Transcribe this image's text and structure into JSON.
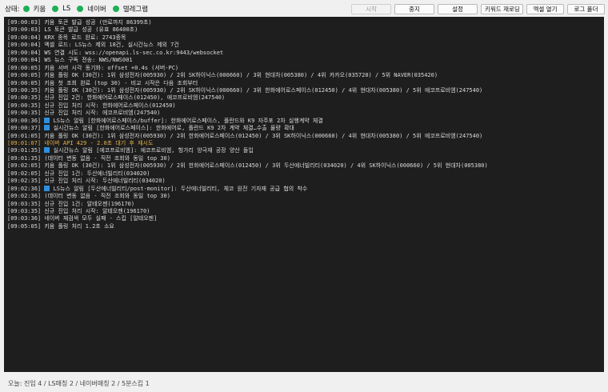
{
  "status": {
    "label": "상태:",
    "indicators": [
      {
        "label": "키움",
        "color": "#1fae55"
      },
      {
        "label": "LS",
        "color": "#1fae55"
      },
      {
        "label": "네이버",
        "color": "#1fae55"
      },
      {
        "label": "텔레그램",
        "color": "#1fae55"
      }
    ]
  },
  "toolbar": {
    "start": "시작",
    "stop": "중지",
    "settings": "설정",
    "keyword_reload": "키워드 재로딩",
    "excel_open": "엑셀 열기",
    "log_folder": "로그 폴더"
  },
  "log": [
    {
      "text": "[09:00:03] 키움 토큰 발급 성공 (만료까지 86399초)"
    },
    {
      "text": "[09:00:03] LS 토큰 발급 성공 (유효 86400초)"
    },
    {
      "text": "[09:00:04] KRX 종목 로드 완료: 2743종목"
    },
    {
      "text": "[09:00:04] 엑셀 로드: LS뉴스 제외 18건, 실시간뉴스 제외 7건"
    },
    {
      "text": "[09:00:04] WS 연결 시도: wss://openapi.ls-sec.co.kr:9443/websocket"
    },
    {
      "text": "[09:00:04] WS 뉴스 구독 전송: NWS/NWS001"
    },
    {
      "text": "[09:00:05] 키움 서버 시각 동기화: offset +0.4s (서버-PC)"
    },
    {
      "text": "[09:00:05] 키움 폴링 OK (30건): 1위 삼성전자(005930) / 2위 SK하이닉스(000660) / 3위 현대차(005380) / 4위 카카오(035720) / 5위 NAVER(035420)"
    },
    {
      "text": "[09:00:05] 키움 첫 조회 완료 (top 30) - 비교 시작은 다음 조회부터"
    },
    {
      "text": "[09:00:35] 키움 폴링 OK (30건): 1위 삼성전자(005930) / 2위 SK하이닉스(000660) / 3위 한화에어로스페이스(012450) / 4위 현대차(005380) / 5위 에코프로비엠(247540)"
    },
    {
      "text": "[09:00:35] 신규 진입 2건: 한화에어로스페이스(012450), 에코프로비엠(247540)"
    },
    {
      "text": "[09:00:35] 신규 진입 처리 시작: 한화에어로스페이스(012450)"
    },
    {
      "text": "[09:00:35] 신규 진입 처리 시작: 에코프로비엠(247540)"
    },
    {
      "text": "LS뉴스 알림 [한화에어로스페이스/buffer]: 한화에어로스페이스, 폴란드와 K9 자주포 2차 실행계약 체결",
      "time": "[09:00:36]",
      "icon": true
    },
    {
      "text": "실시간뉴스 알림 [한화에어로스페이스]: 한화에어로, 폴란드 K9 2차 계약 체결…수출 물량 확대",
      "time": "[09:00:37]",
      "icon": true
    },
    {
      "text": "[09:01:05] 키움 폴링 OK (30건): 1위 삼성전자(005930) / 2위 한화에어로스페이스(012450) / 3위 SK하이닉스(000660) / 4위 현대차(005380) / 5위 에코프로비엠(247540)"
    },
    {
      "text": "[09:01:07] 네이버 API 429 - 2.0초 대기 후 재시도",
      "warn": true
    },
    {
      "text": "실시간뉴스 알림 [에코프로비엠]: 에코프로비엠, 헝가리 양극재 공장 양산 돌입",
      "time": "[09:01:35]",
      "icon": true
    },
    {
      "text": "[09:01:35] (데이터 변동 없음 - 직전 조회와 동일 top 30)"
    },
    {
      "text": "[09:02:05] 키움 폴링 OK (30건): 1위 삼성전자(005930) / 2위 한화에어로스페이스(012450) / 3위 두산에너빌리티(034020) / 4위 SK하이닉스(000660) / 5위 현대차(005380)"
    },
    {
      "text": "[09:02:05] 신규 진입 1건: 두산에너빌리티(034020)"
    },
    {
      "text": "[09:02:35] 신규 진입 처리 시작: 두산에너빌리티(034020)"
    },
    {
      "text": "LS뉴스 알림 [두산에너빌리티/post-monitor]: 두산에너빌리티, 체코 원전 기자재 공급 협의 착수",
      "time": "[09:02:36]",
      "icon": true
    },
    {
      "text": "[09:02:36] (데이터 변동 없음 - 직전 조회와 동일 top 30)"
    },
    {
      "text": "[09:03:35] 신규 진입 1건: 알테오젠(196170)"
    },
    {
      "text": "[09:03:35] 신규 진입 처리 시작: 알테오젠(196170)"
    },
    {
      "text": "[09:03:36] 네이버 재검색 모두 실패 - 스킵 [알테오젠]"
    },
    {
      "text": "[09:05:05] 키움 폴링 처리 1.2초 소요"
    }
  ],
  "footer": "오늘: 진입 4 / LS매칭 2 / 네이버매칭 2 / 5분스킵 1"
}
